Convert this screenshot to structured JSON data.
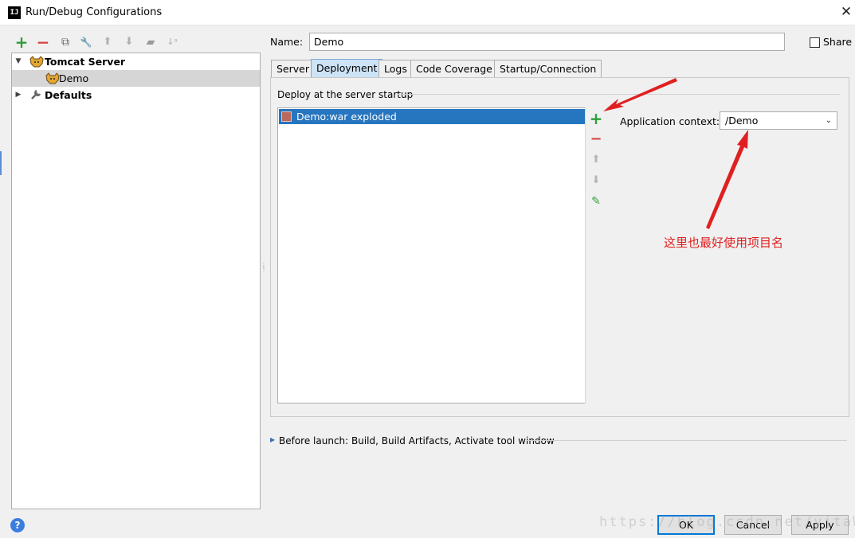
{
  "window": {
    "title": "Run/Debug Configurations",
    "logo_text": "IJ",
    "close_glyph": "✕"
  },
  "toolbar": {
    "icons": [
      "add-icon",
      "remove-icon",
      "copy-icon",
      "edit-defaults-icon",
      "move-up-icon",
      "move-down-icon",
      "folder-icon",
      "sort-icon"
    ],
    "add_glyph": "+",
    "remove_glyph": "−",
    "copy_glyph": "⧉",
    "wrench_glyph": "🔧",
    "up_glyph": "⬆",
    "down_glyph": "⬇",
    "folder_glyph": "▰",
    "sort_glyph": "↓ᵃ",
    "add_color": "#2e9e3a",
    "remove_color": "#d64545"
  },
  "tree": {
    "items": [
      {
        "label": "Tomcat Server",
        "bold": true,
        "expanded": true
      },
      {
        "label": "Demo",
        "selected": true
      },
      {
        "label": "Defaults",
        "bold": true,
        "expanded": false
      }
    ],
    "expanded_glyph": "▼",
    "collapsed_glyph": "▶",
    "selected_bg": "#d6d6d6"
  },
  "name": {
    "label": "Name:",
    "value": "Demo"
  },
  "share": {
    "label": "Share",
    "checked": false
  },
  "tabs": [
    {
      "label": "Server",
      "active": false
    },
    {
      "label": "Deployment",
      "active": true
    },
    {
      "label": "Logs",
      "active": false
    },
    {
      "label": "Code Coverage",
      "active": false
    },
    {
      "label": "Startup/Connection",
      "active": false
    }
  ],
  "deployment": {
    "legend": "Deploy at the server startup",
    "artifacts": [
      "Demo:war exploded"
    ],
    "side_tools": {
      "add": "+",
      "remove": "−",
      "up": "⬆",
      "down": "⬇",
      "edit": "✎"
    },
    "app_context_label": "Application context:",
    "app_context_value": "/Demo",
    "dropdown_glyph": "⌄"
  },
  "before_launch": {
    "arrow": "▶",
    "label": "Before launch: Build, Build Artifacts, Activate tool window"
  },
  "annotation": {
    "text": "这里也最好使用项目名",
    "color": "#e02020"
  },
  "footer": {
    "help_glyph": "?",
    "ok_label": "OK",
    "cancel_label": "Cancel",
    "apply_label": "Apply",
    "watermark": "https://blog.csdn.net/yjtaWD97"
  },
  "colors": {
    "accent": "#2675bf",
    "active_tab": "#cde3f6",
    "default_button_border": "#0078d7"
  }
}
